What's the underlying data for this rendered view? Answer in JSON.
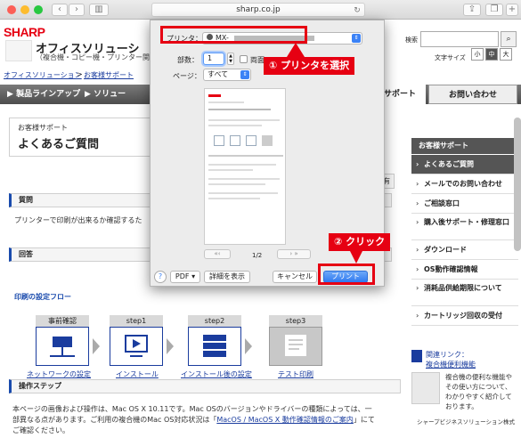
{
  "browser": {
    "url": "sharp.co.jp"
  },
  "header": {
    "logo": "SHARP",
    "title": "オフィスソリューシ",
    "subtitle": "（複合機・コピー機・プリンター関",
    "search_label": "検索",
    "font_size_label": "文字サイズ",
    "font_sizes": [
      "小",
      "中",
      "大"
    ]
  },
  "breadcrumbs": [
    "オフィスソリューション",
    "お客様サポート"
  ],
  "nav": {
    "item1": "製品ラインアップ",
    "item2": "ソリュー",
    "active": "サポート",
    "contact": "お問い合わせ"
  },
  "main": {
    "support_label": "お客様サポート",
    "page_title": "よくあるご質問",
    "question_header": "質問",
    "question_text": "プリンターで印刷が出来るか確認するた",
    "answer_header": "回答",
    "flow_title": "印刷の設定フロー",
    "steps": [
      {
        "header": "事前確認",
        "link": "ネットワークの設定"
      },
      {
        "header": "step1",
        "link": "インストール"
      },
      {
        "header": "step2",
        "link": "インストール後の設定"
      },
      {
        "header": "step3",
        "link": "テスト印刷"
      }
    ],
    "ops_header": "操作ステップ",
    "ops_text1": "本ページの画像および操作は、Mac OS X 10.11です。Mac OSのバージョンやドライバーの種類によっては、一",
    "ops_text2_pre": "部異なる点があります。ご利用の複合機のMac OS対応状況は「",
    "ops_text2_link": "MacOS / MacOS X 動作確認情報のご案内",
    "ops_text2_post": "」にて",
    "ops_text3": "ご確認ください。",
    "partial_right": "有"
  },
  "sidebar": {
    "header": "お客様サポート",
    "items": [
      "よくあるご質問",
      "メールでのお問い合わせ",
      "ご相談窓口",
      "購入後サポート・修理窓口",
      "ダウンロード",
      "OS動作確認情報",
      "消耗品供給期限について",
      "カートリッジ回収の受付"
    ],
    "related_title": "関連リンク：",
    "related_link": "複合機便利機能",
    "related_desc": "複合機の便利な機能やその使い方について、わかりやすく紹介しております。",
    "footer": "シャープビジネスソリューション株式"
  },
  "dialog": {
    "printer_label": "プリンタ：",
    "printer_value": "MX-",
    "copies_label": "部数：",
    "copies_value": "1",
    "duplex_label": "両面",
    "pages_label": "ページ：",
    "pages_value": "すべて",
    "page_indicator": "1/2",
    "pdf_label": "PDF",
    "details_label": "詳細を表示",
    "cancel_label": "キャンセル",
    "print_label": "プリント",
    "help_label": "?"
  },
  "annotations": {
    "callout1": "① プリンタを選択",
    "callout2": "② クリック",
    "accent": "#e60012"
  }
}
